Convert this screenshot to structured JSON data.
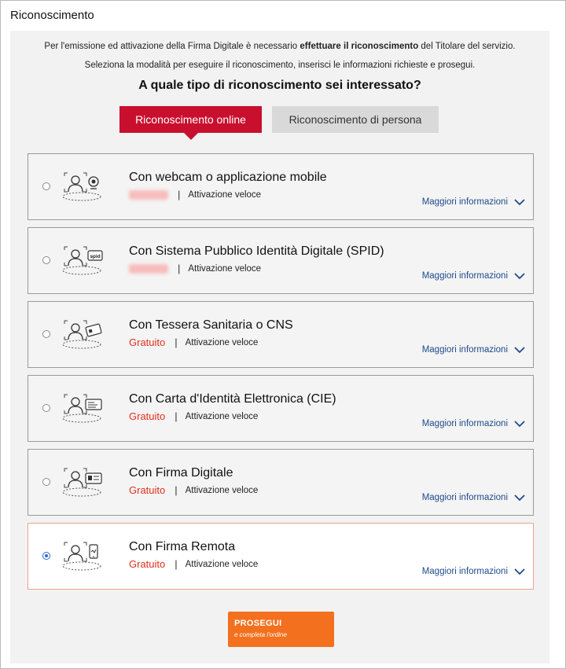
{
  "page": {
    "title": "Riconoscimento",
    "intro_line1_before": "Per l'emissione ed attivazione della Firma Digitale è necessario ",
    "intro_line1_bold": "effettuare il riconoscimento",
    "intro_line1_after": " del Titolare del servizio.",
    "intro_line2": "Seleziona la modalità per eseguire il riconoscimento, inserisci le informazioni richieste e prosegui.",
    "question": "A quale tipo di riconoscimento sei interessato?"
  },
  "tabs": [
    {
      "label": "Riconoscimento online",
      "active": true
    },
    {
      "label": "Riconoscimento di persona",
      "active": false
    }
  ],
  "options": [
    {
      "title": "Con webcam o applicazione mobile",
      "price": "",
      "price_blurred": true,
      "speed": "Attivazione veloce",
      "more": "Maggiori informazioni",
      "icon": "webcam-icon",
      "selected": false
    },
    {
      "title": "Con Sistema Pubblico Identità Digitale (SPID)",
      "price": "",
      "price_blurred": true,
      "speed": "Attivazione veloce",
      "more": "Maggiori informazioni",
      "icon": "spid-icon",
      "selected": false
    },
    {
      "title": "Con Tessera Sanitaria o CNS",
      "price": "Gratuito",
      "price_blurred": false,
      "speed": "Attivazione veloce",
      "more": "Maggiori informazioni",
      "icon": "health-card-icon",
      "selected": false
    },
    {
      "title": "Con Carta d'Identità Elettronica (CIE)",
      "price": "Gratuito",
      "price_blurred": false,
      "speed": "Attivazione veloce",
      "more": "Maggiori informazioni",
      "icon": "id-card-icon",
      "selected": false
    },
    {
      "title": "Con Firma Digitale",
      "price": "Gratuito",
      "price_blurred": false,
      "speed": "Attivazione veloce",
      "more": "Maggiori informazioni",
      "icon": "digital-signature-card-icon",
      "selected": false
    },
    {
      "title": "Con Firma Remota",
      "price": "Gratuito",
      "price_blurred": false,
      "speed": "Attivazione veloce",
      "more": "Maggiori informazioni",
      "icon": "remote-signature-phone-icon",
      "selected": true
    }
  ],
  "cta": {
    "label": "PROSEGUI",
    "sublabel": "e completa l'ordine"
  },
  "colors": {
    "accent_red": "#c8102e",
    "price_red": "#e0301e",
    "link_blue": "#1f4a8c",
    "cta_orange": "#f3701e",
    "selected_border": "#f0a090"
  }
}
